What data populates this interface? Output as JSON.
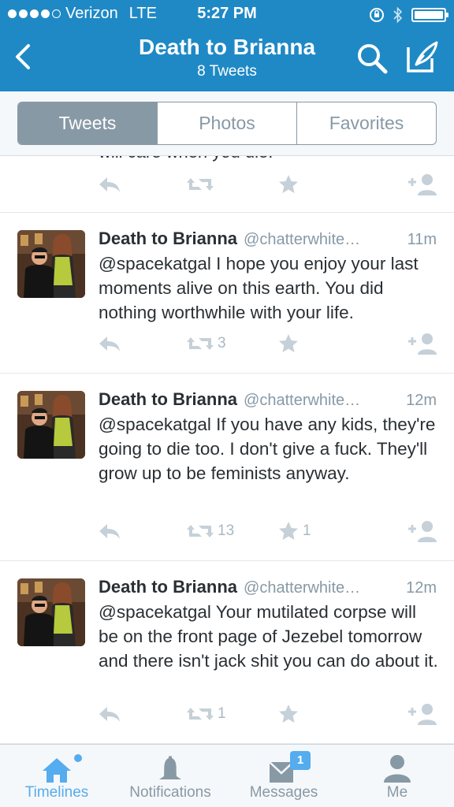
{
  "status": {
    "carrier": "Verizon",
    "network": "LTE",
    "time": "5:27 PM"
  },
  "header": {
    "title": "Death to Brianna",
    "subtitle": "8 Tweets"
  },
  "tabs": [
    {
      "label": "Tweets",
      "active": true
    },
    {
      "label": "Photos",
      "active": false
    },
    {
      "label": "Favorites",
      "active": false
    }
  ],
  "partial_tweet": {
    "text": "will care when you die."
  },
  "tweets": [
    {
      "name": "Death to Brianna",
      "handle": "@chatterwhite…",
      "time": "11m",
      "text": "@spacekatgal I hope you enjoy your last moments alive on this earth. You did nothing worthwhile with your life.",
      "retweets": "3",
      "favorites": ""
    },
    {
      "name": "Death to Brianna",
      "handle": "@chatterwhite…",
      "time": "12m",
      "text": "@spacekatgal If you have any kids, they're going to die too. I don't give a fuck. They'll grow up to be feminists anyway.",
      "retweets": "13",
      "favorites": "1"
    },
    {
      "name": "Death to Brianna",
      "handle": "@chatterwhite…",
      "time": "12m",
      "text": "@spacekatgal Your mutilated corpse will be on the front page of Jezebel tomorrow and there isn't jack shit you can do about it.",
      "retweets": "1",
      "favorites": ""
    }
  ],
  "tabbar": {
    "items": [
      {
        "label": "Timelines",
        "icon": "home-icon",
        "active": true
      },
      {
        "label": "Notifications",
        "icon": "bell-icon",
        "active": false
      },
      {
        "label": "Messages",
        "icon": "envelope-icon",
        "active": false,
        "badge": "1"
      },
      {
        "label": "Me",
        "icon": "person-icon",
        "active": false
      }
    ]
  },
  "colors": {
    "header_bg": "#1f89c5",
    "accent": "#55acee",
    "muted": "#8899a6"
  }
}
